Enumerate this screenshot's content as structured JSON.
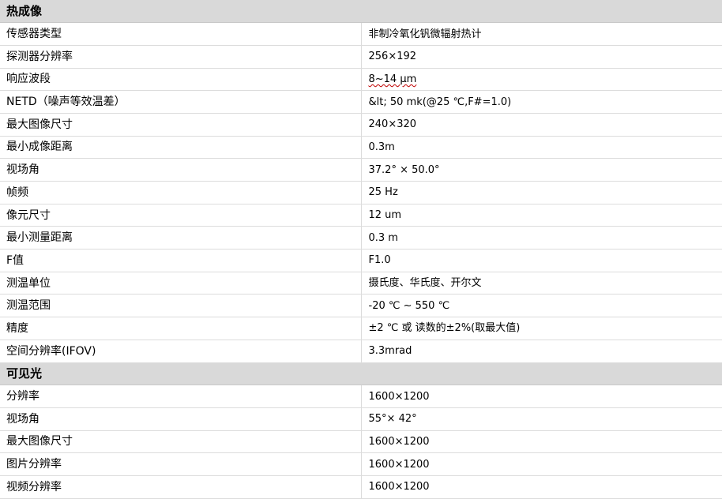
{
  "sections": [
    {
      "title": "热成像",
      "rows": [
        {
          "label": "传感器类型",
          "value": "非制冷氧化钒微辐射热计"
        },
        {
          "label": "探测器分辨率",
          "value": "256×192"
        },
        {
          "label": "响应波段",
          "value": "8~14 µm"
        },
        {
          "label": "NETD（噪声等效温差）",
          "value": "&lt; 50 mk(@25 ℃,F#=1.0)"
        },
        {
          "label": "最大图像尺寸",
          "value": "240×320"
        },
        {
          "label": "最小成像距离",
          "value": "0.3m"
        },
        {
          "label": "视场角",
          "value": "37.2° × 50.0°"
        },
        {
          "label": "帧频",
          "value": "25 Hz"
        },
        {
          "label": "像元尺寸",
          "value": "12 um"
        },
        {
          "label": "最小测量距离",
          "value": "0.3 m"
        },
        {
          "label": "F值",
          "value": "F1.0"
        },
        {
          "label": "测温单位",
          "value": "摄氏度、华氏度、开尔文"
        },
        {
          "label": "测温范围",
          "value": "-20 ℃ ~ 550 ℃"
        },
        {
          "label": "精度",
          "value": "±2 ℃ 或 读数的±2%(取最大值)"
        },
        {
          "label": "空间分辨率(IFOV)",
          "value": "3.3mrad"
        }
      ]
    },
    {
      "title": "可见光",
      "rows": [
        {
          "label": "分辨率",
          "value": "1600×1200"
        },
        {
          "label": "视场角",
          "value": "55°× 42°"
        },
        {
          "label": "最大图像尺寸",
          "value": "1600×1200"
        },
        {
          "label": "图片分辨率",
          "value": "1600×1200"
        },
        {
          "label": "视频分辨率",
          "value": "1600×1200"
        }
      ]
    }
  ]
}
